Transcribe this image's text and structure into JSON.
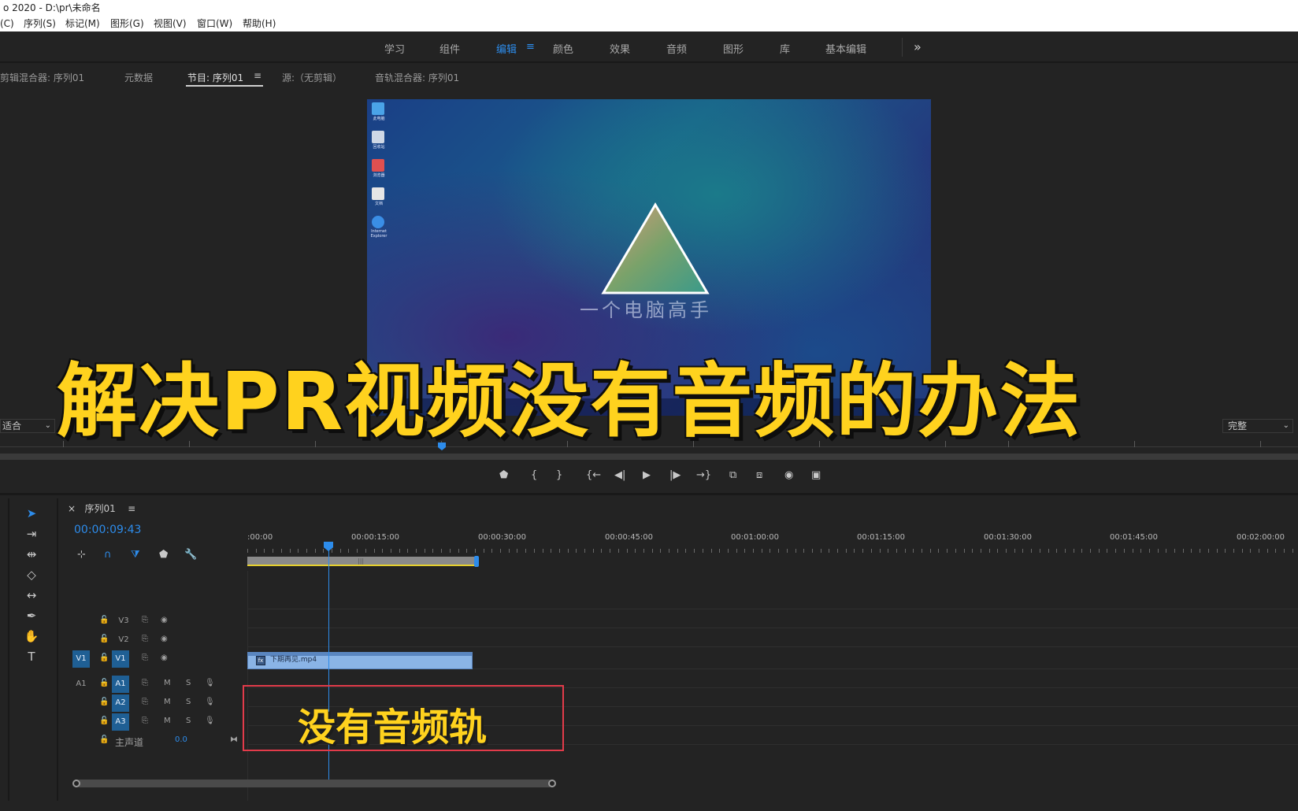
{
  "app": {
    "title": "o 2020 - D:\\pr\\未命名",
    "menu": [
      "(C)",
      "序列(S)",
      "标记(M)",
      "图形(G)",
      "视图(V)",
      "窗口(W)",
      "帮助(H)"
    ]
  },
  "workspaces": {
    "tabs": [
      "学习",
      "组件",
      "编辑",
      "颜色",
      "效果",
      "音频",
      "图形",
      "库",
      "基本编辑"
    ],
    "active": "编辑",
    "menu_icon": "≡",
    "more_icon": "»"
  },
  "monitor": {
    "tabs": [
      "剪辑混合器: 序列01",
      "元数据",
      "节目: 序列01",
      "源:（无剪辑）",
      "音轨混合器: 序列01"
    ],
    "active_tab": "节目: 序列01",
    "tab_menu": "≡",
    "fit": "适合",
    "quality": "完整",
    "dropdown_arrow": "⌄",
    "frame": {
      "watermark": "一个电脑高手",
      "desktop_icons": [
        "此电脑",
        "回收站",
        "浏览器",
        "文档",
        "Internet Explorer"
      ],
      "colors": {
        "triangle_stroke": "#ffffff",
        "bg_accent": "#1b7a8a"
      }
    },
    "transport_icons": [
      "marker-icon",
      "in-point-icon",
      "out-point-icon",
      "go-to-in-icon",
      "step-back-icon",
      "play-icon",
      "step-forward-icon",
      "go-to-out-icon",
      "lift-icon",
      "extract-icon",
      "export-frame-icon",
      "compare-icon"
    ],
    "transport_glyphs": [
      "⬟",
      "{",
      "}",
      "{←",
      "◀|",
      "▶",
      "|▶",
      "→}",
      "⧉",
      "⧈",
      "◉",
      "▣"
    ]
  },
  "timeline": {
    "sequence_name": "序列01",
    "close_glyph": "×",
    "menu_glyph": "≡",
    "timecode": "00:00:09:43",
    "ruler_labels": [
      ":00:00",
      "00:00:15:00",
      "00:00:30:00",
      "00:00:45:00",
      "00:01:00:00",
      "00:01:15:00",
      "00:01:30:00",
      "00:01:45:00",
      "00:02:00:00"
    ],
    "tracks": {
      "video": [
        {
          "name": "V3",
          "source": "",
          "targeted": false
        },
        {
          "name": "V2",
          "source": "",
          "targeted": false
        },
        {
          "name": "V1",
          "source": "V1",
          "targeted": true
        }
      ],
      "audio": [
        {
          "name": "A1",
          "source": "A1",
          "targeted": true
        },
        {
          "name": "A2",
          "source": "",
          "targeted": true
        },
        {
          "name": "A3",
          "source": "",
          "targeted": true
        }
      ],
      "master": {
        "label": "主声道",
        "value": "0.0"
      },
      "mute_label": "M",
      "solo_label": "S"
    },
    "clip": {
      "name": "下期再见.mp4",
      "fx": "fx"
    },
    "tools": [
      "selection-tool-icon",
      "track-select-icon",
      "ripple-edit-icon",
      "razor-icon",
      "slip-icon",
      "pen-icon",
      "hand-icon",
      "type-icon"
    ],
    "tool_glyphs": [
      "➤",
      "⇥",
      "⇹",
      "◇",
      "↔",
      "✒",
      "✋",
      "T"
    ],
    "track_ctrl_glyphs": [
      "⊹",
      "∩",
      "⧩",
      "⬟",
      "🔧"
    ]
  },
  "annotation": {
    "title": "解决PR视频没有音频的办法",
    "label": "没有音频轨",
    "colors": {
      "text": "#ffd21e",
      "box": "#e23b4a",
      "accent_blue": "#2d8ceb"
    }
  }
}
